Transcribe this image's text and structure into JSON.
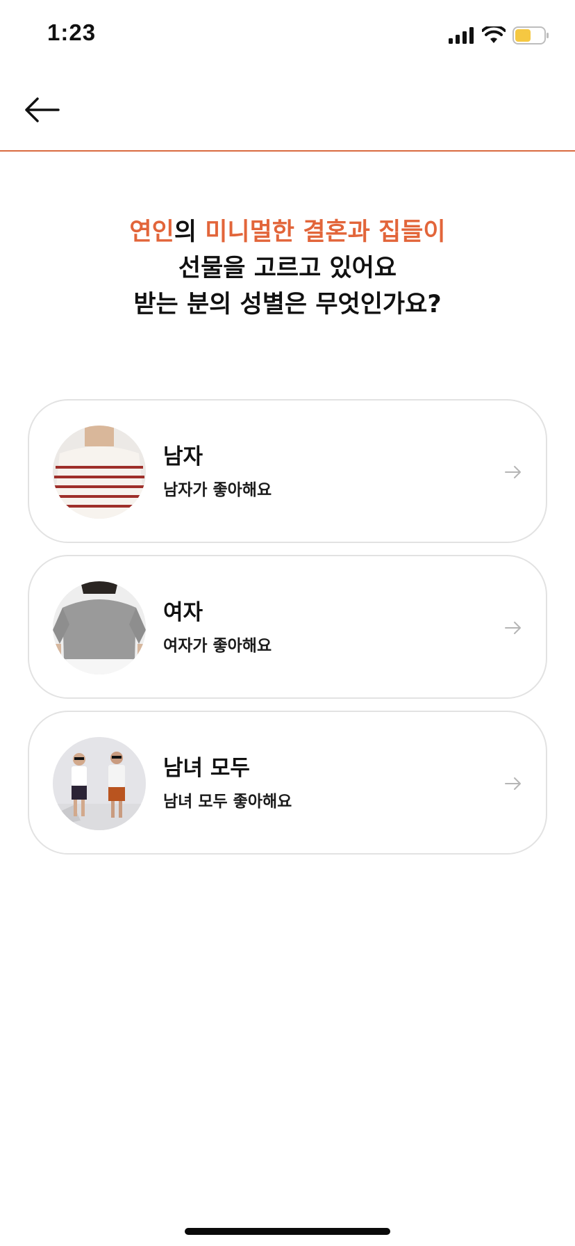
{
  "status_bar": {
    "time": "1:23",
    "signal_icon": "cellular-signal-icon",
    "wifi_icon": "wifi-icon",
    "battery_icon": "battery-icon",
    "battery_color": "#f5c842"
  },
  "header": {
    "back_icon": "arrow-left-icon",
    "divider_color": "#d96a3f"
  },
  "question": {
    "recipient": "연인",
    "part1": "의 ",
    "occasion": "미니멀한 결혼과 집들이",
    "line2": "선물을 고르고 있어요",
    "line3": "받는 분의 성별은 무엇인가요?"
  },
  "accent_color": "#e2653a",
  "options": [
    {
      "title": "남자",
      "subtitle": "남자가 좋아해요",
      "image": "man-in-striped-shirt-photo",
      "arrow_icon": "arrow-right-icon"
    },
    {
      "title": "여자",
      "subtitle": "여자가 좋아해요",
      "image": "woman-in-gray-knit-photo",
      "arrow_icon": "arrow-right-icon"
    },
    {
      "title": "남녀 모두",
      "subtitle": "남녀 모두 좋아해요",
      "image": "couple-standing-photo",
      "arrow_icon": "arrow-right-icon"
    }
  ]
}
